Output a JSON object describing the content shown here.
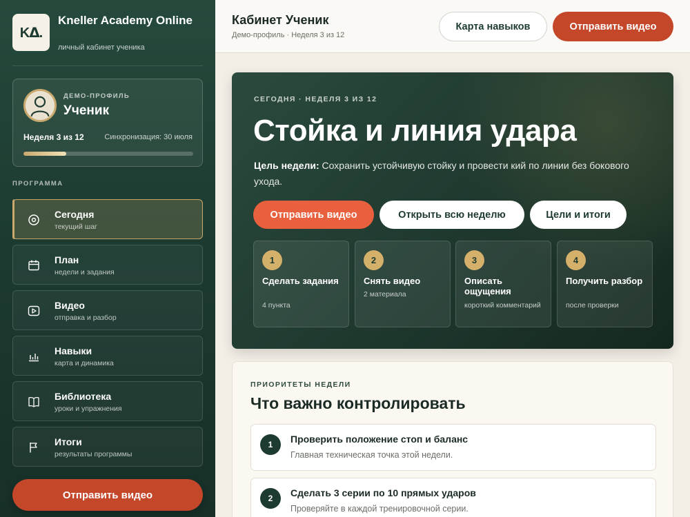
{
  "brand": {
    "logo_text": "Kᐃ.",
    "title": "Kneller Academy Online",
    "subtitle": "личный кабинет ученика"
  },
  "profile": {
    "kicker": "ДЕМО-ПРОФИЛЬ",
    "name": "Ученик",
    "week": "Неделя 3 из 12",
    "sync": "Синхронизация: 30 июля",
    "progress_fraction": 0.25
  },
  "sidebar": {
    "section_label": "ПРОГРАММА",
    "items": [
      {
        "title": "Сегодня",
        "subtitle": "текущий шаг",
        "icon": "target-icon",
        "active": true
      },
      {
        "title": "План",
        "subtitle": "недели и задания",
        "icon": "calendar-icon",
        "active": false
      },
      {
        "title": "Видео",
        "subtitle": "отправка и разбор",
        "icon": "play-icon",
        "active": false
      },
      {
        "title": "Навыки",
        "subtitle": "карта и динамика",
        "icon": "bar-chart-icon",
        "active": false
      },
      {
        "title": "Библиотека",
        "subtitle": "уроки и упражнения",
        "icon": "book-icon",
        "active": false
      },
      {
        "title": "Итоги",
        "subtitle": "результаты программы",
        "icon": "flag-icon",
        "active": false
      }
    ],
    "cta_label": "Отправить видео"
  },
  "topbar": {
    "title": "Кабинет Ученик",
    "subtitle": "Демо-профиль · Неделя 3 из 12",
    "skills_map_label": "Карта навыков",
    "send_video_label": "Отправить видео"
  },
  "hero": {
    "kicker": "СЕГОДНЯ · НЕДЕЛЯ 3 ИЗ 12",
    "title": "Стойка и линия удара",
    "goal_label": "Цель недели:",
    "goal_text": " Сохранить устойчивую стойку и провести кий по линии без бокового ухода.",
    "buttons": {
      "send_video": "Отправить видео",
      "open_week": "Открыть всю неделю",
      "goals": "Цели и итоги"
    },
    "steps": [
      {
        "num": "1",
        "title": "Сделать задания",
        "subtitle": "4 пункта"
      },
      {
        "num": "2",
        "title": "Снять видео",
        "subtitle": "2 материала"
      },
      {
        "num": "3",
        "title": "Описать ощущения",
        "subtitle": "короткий комментарий"
      },
      {
        "num": "4",
        "title": "Получить разбор",
        "subtitle": "после проверки"
      }
    ]
  },
  "priorities": {
    "kicker": "ПРИОРИТЕТЫ НЕДЕЛИ",
    "title": "Что важно контролировать",
    "items": [
      {
        "num": "1",
        "title": "Проверить положение стоп и баланс",
        "desc": "Главная техническая точка этой недели."
      },
      {
        "num": "2",
        "title": "Сделать 3 серии по 10 прямых ударов",
        "desc": "Проверяйте в каждой тренировочной серии."
      }
    ]
  },
  "colors": {
    "sidebar_green": "#1d3b31",
    "accent_red": "#c4472a",
    "hero_button_orange": "#e8603e",
    "gold": "#c9a96e"
  }
}
